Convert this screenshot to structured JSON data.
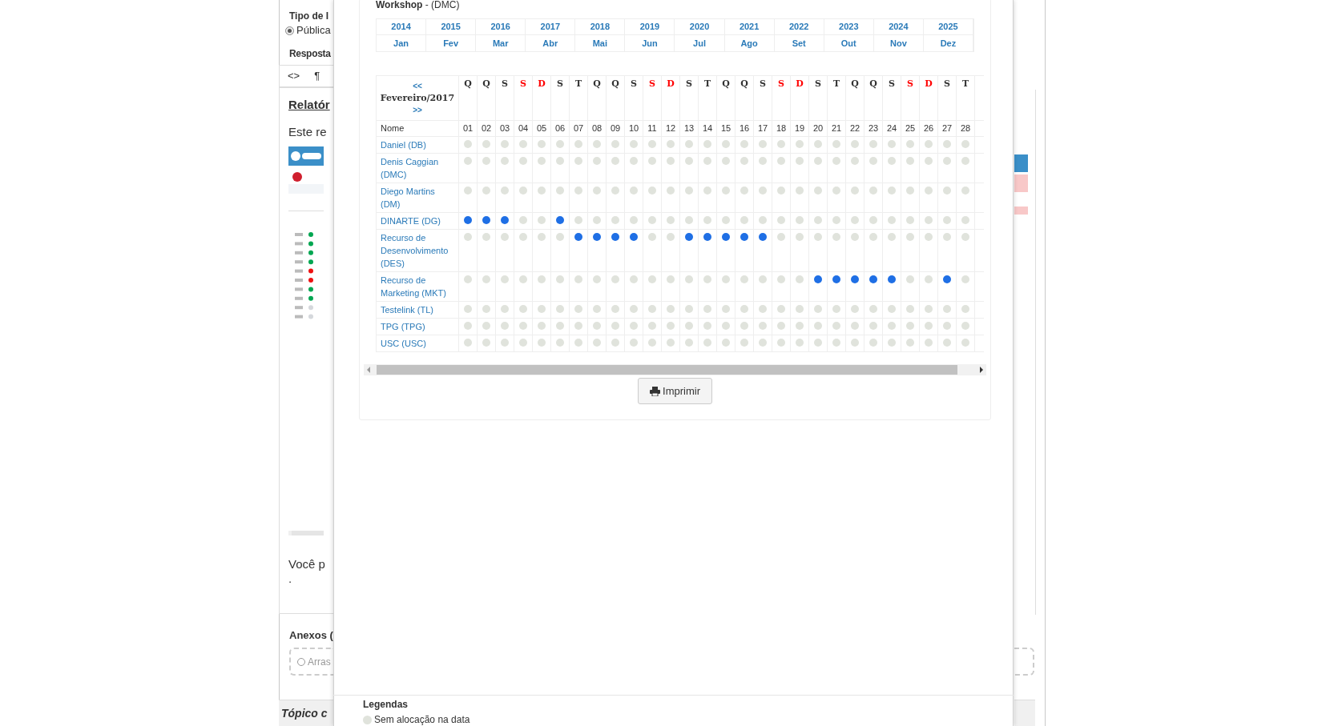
{
  "background_form": {
    "type_label": "Tipo de I",
    "radio": {
      "label": "Pública",
      "checked": true
    },
    "response_label": "Resposta",
    "toolbar": [
      "<>",
      "¶"
    ],
    "editor": {
      "heading": "Relatór",
      "paragraph": "Este re",
      "footer_text": "Você p",
      "footer_dot": "."
    },
    "attachments_label": "Anexos (",
    "dropzone": "Arras",
    "topic_header": "Tópico c"
  },
  "modal": {
    "title": "Workshop",
    "subtitle": " - (DMC)",
    "years": [
      "2014",
      "2015",
      "2016",
      "2017",
      "2018",
      "2019",
      "2020",
      "2021",
      "2022",
      "2023",
      "2024",
      "2025"
    ],
    "months": [
      "Jan",
      "Fev",
      "Mar",
      "Abr",
      "Mai",
      "Jun",
      "Jul",
      "Ago",
      "Set",
      "Out",
      "Nov",
      "Dez"
    ],
    "calendar": {
      "prev": "<<",
      "month_label": "Fevereiro/2017",
      "next": ">>",
      "name_header": "Nome",
      "days": [
        {
          "letter": "Q",
          "number": "01",
          "weekend": false
        },
        {
          "letter": "Q",
          "number": "02",
          "weekend": false
        },
        {
          "letter": "S",
          "number": "03",
          "weekend": false
        },
        {
          "letter": "S",
          "number": "04",
          "weekend": true
        },
        {
          "letter": "D",
          "number": "05",
          "weekend": true
        },
        {
          "letter": "S",
          "number": "06",
          "weekend": false
        },
        {
          "letter": "T",
          "number": "07",
          "weekend": false
        },
        {
          "letter": "Q",
          "number": "08",
          "weekend": false
        },
        {
          "letter": "Q",
          "number": "09",
          "weekend": false
        },
        {
          "letter": "S",
          "number": "10",
          "weekend": false
        },
        {
          "letter": "S",
          "number": "11",
          "weekend": true
        },
        {
          "letter": "D",
          "number": "12",
          "weekend": true
        },
        {
          "letter": "S",
          "number": "13",
          "weekend": false
        },
        {
          "letter": "T",
          "number": "14",
          "weekend": false
        },
        {
          "letter": "Q",
          "number": "15",
          "weekend": false
        },
        {
          "letter": "Q",
          "number": "16",
          "weekend": false
        },
        {
          "letter": "S",
          "number": "17",
          "weekend": false
        },
        {
          "letter": "S",
          "number": "18",
          "weekend": true
        },
        {
          "letter": "D",
          "number": "19",
          "weekend": true
        },
        {
          "letter": "S",
          "number": "20",
          "weekend": false
        },
        {
          "letter": "T",
          "number": "21",
          "weekend": false
        },
        {
          "letter": "Q",
          "number": "22",
          "weekend": false
        },
        {
          "letter": "Q",
          "number": "23",
          "weekend": false
        },
        {
          "letter": "S",
          "number": "24",
          "weekend": false
        },
        {
          "letter": "S",
          "number": "25",
          "weekend": true
        },
        {
          "letter": "D",
          "number": "26",
          "weekend": true
        },
        {
          "letter": "S",
          "number": "27",
          "weekend": false
        },
        {
          "letter": "T",
          "number": "28",
          "weekend": false
        }
      ],
      "rows": [
        {
          "name": "Daniel (DB)",
          "allocated": [
            false,
            false,
            false,
            false,
            false,
            false,
            false,
            false,
            false,
            false,
            false,
            false,
            false,
            false,
            false,
            false,
            false,
            false,
            false,
            false,
            false,
            false,
            false,
            false,
            false,
            false,
            false,
            false
          ]
        },
        {
          "name": "Denis Caggian (DMC)",
          "allocated": [
            false,
            false,
            false,
            false,
            false,
            false,
            false,
            false,
            false,
            false,
            false,
            false,
            false,
            false,
            false,
            false,
            false,
            false,
            false,
            false,
            false,
            false,
            false,
            false,
            false,
            false,
            false,
            false
          ]
        },
        {
          "name": "Diego Martins (DM)",
          "allocated": [
            false,
            false,
            false,
            false,
            false,
            false,
            false,
            false,
            false,
            false,
            false,
            false,
            false,
            false,
            false,
            false,
            false,
            false,
            false,
            false,
            false,
            false,
            false,
            false,
            false,
            false,
            false,
            false
          ]
        },
        {
          "name": "DINARTE (DG)",
          "allocated": [
            true,
            true,
            true,
            false,
            false,
            true,
            false,
            false,
            false,
            false,
            false,
            false,
            false,
            false,
            false,
            false,
            false,
            false,
            false,
            false,
            false,
            false,
            false,
            false,
            false,
            false,
            false,
            false
          ]
        },
        {
          "name": "Recurso de Desenvolvimento (DES)",
          "allocated": [
            false,
            false,
            false,
            false,
            false,
            false,
            true,
            true,
            true,
            true,
            false,
            false,
            true,
            true,
            true,
            true,
            true,
            false,
            false,
            false,
            false,
            false,
            false,
            false,
            false,
            false,
            false,
            false
          ]
        },
        {
          "name": "Recurso de Marketing (MKT)",
          "allocated": [
            false,
            false,
            false,
            false,
            false,
            false,
            false,
            false,
            false,
            false,
            false,
            false,
            false,
            false,
            false,
            false,
            false,
            false,
            false,
            true,
            true,
            true,
            true,
            true,
            false,
            false,
            true,
            false
          ]
        },
        {
          "name": "Testelink (TL)",
          "allocated": [
            false,
            false,
            false,
            false,
            false,
            false,
            false,
            false,
            false,
            false,
            false,
            false,
            false,
            false,
            false,
            false,
            false,
            false,
            false,
            false,
            false,
            false,
            false,
            false,
            false,
            false,
            false,
            false
          ]
        },
        {
          "name": "TPG (TPG)",
          "allocated": [
            false,
            false,
            false,
            false,
            false,
            false,
            false,
            false,
            false,
            false,
            false,
            false,
            false,
            false,
            false,
            false,
            false,
            false,
            false,
            false,
            false,
            false,
            false,
            false,
            false,
            false,
            false,
            false
          ]
        },
        {
          "name": "USC (USC)",
          "allocated": [
            false,
            false,
            false,
            false,
            false,
            false,
            false,
            false,
            false,
            false,
            false,
            false,
            false,
            false,
            false,
            false,
            false,
            false,
            false,
            false,
            false,
            false,
            false,
            false,
            false,
            false,
            false,
            false
          ]
        }
      ]
    },
    "print_button": "Imprimir",
    "legend": {
      "title": "Legendas",
      "items": [
        {
          "label": "Sem alocação na data",
          "color": "#e0e3dc"
        }
      ]
    }
  }
}
